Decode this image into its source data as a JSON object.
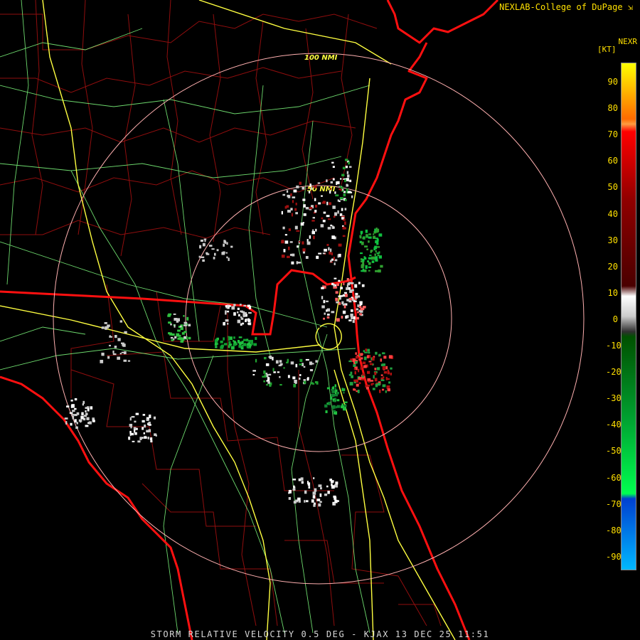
{
  "header": {
    "credit": "NEXLAB-College of DuPage",
    "product": "NEXR",
    "unit": "[KT]"
  },
  "range_rings": [
    {
      "label": "100 NMI",
      "radius_nmi": 100
    },
    {
      "label": "50 NMI",
      "radius_nmi": 50
    }
  ],
  "legend": {
    "ticks": [
      "90",
      "80",
      "70",
      "60",
      "50",
      "40",
      "30",
      "20",
      "10",
      "0",
      "-10",
      "-20",
      "-30",
      "-40",
      "-50",
      "-60",
      "-70",
      "-80",
      "-90"
    ],
    "colors": {
      "max": "#ffff00",
      "orange": "#ff9d40",
      "red": "#ff0000",
      "darkred": "#4a0000",
      "gray": "#cccccc",
      "darkgreen": "#005000",
      "green": "#00ff50",
      "blue": "#0040d0",
      "min": "#00b8ff"
    }
  },
  "caption": "STORM RELATIVE VELOCITY 0.5 DEG - KJAX 13 DEC 25 11:51",
  "colors": {
    "coast": "#ff0000",
    "county": "#b01010",
    "highway": "#ffff50",
    "road": "#80ff80",
    "ring": "#ffb0b0"
  }
}
